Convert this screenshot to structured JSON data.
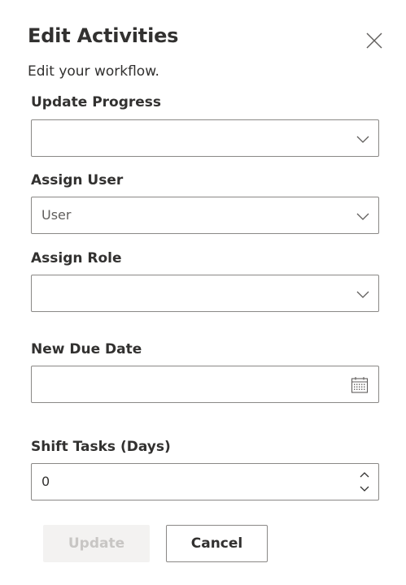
{
  "panel": {
    "title": "Edit Activities",
    "subtitle": "Edit your workflow."
  },
  "form": {
    "update_progress": {
      "label": "Update Progress",
      "value": ""
    },
    "assign_user": {
      "label": "Assign User",
      "placeholder": "User",
      "value": ""
    },
    "assign_role": {
      "label": "Assign Role",
      "value": ""
    },
    "new_due_date": {
      "label": "New Due Date",
      "value": ""
    },
    "shift_tasks": {
      "label": "Shift Tasks (Days)",
      "value": "0"
    }
  },
  "actions": {
    "update_label": "Update",
    "cancel_label": "Cancel"
  },
  "icons": {
    "close": "close-icon",
    "chevron": "chevron-down-icon",
    "calendar": "calendar-icon",
    "spin_up": "chevron-up-icon",
    "spin_down": "chevron-down-icon"
  },
  "colors": {
    "text": "#323130",
    "border": "#8a8886",
    "disabled_bg": "#f3f2f1",
    "disabled_text": "#c8c6c4"
  }
}
